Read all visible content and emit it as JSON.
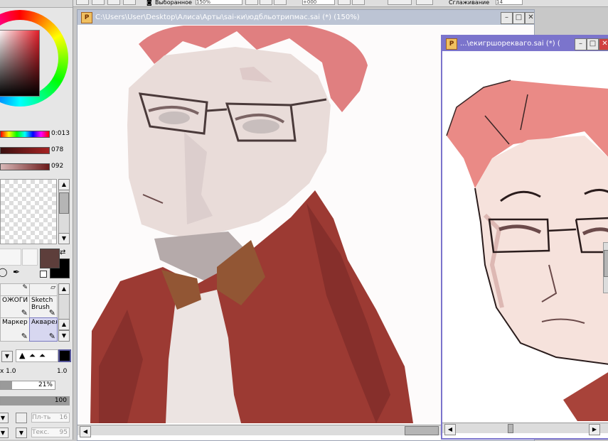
{
  "toolbar": {
    "stabilizer_label": "Выборанное",
    "zoom_value": "150%",
    "angle_value": "+000",
    "smoothing_label": "Сглаживание",
    "smoothing_value": "14"
  },
  "color_panel": {
    "hue_value": "0:013",
    "saturation_value": "078",
    "value_value": "092"
  },
  "colors": {
    "foreground": "#5d3e3b",
    "background": "#000000",
    "doc1_titlebar": "#bcc4d4",
    "doc2_titlebar": "#7b74cc"
  },
  "tools": {
    "contour_label": "ОЖОГИ",
    "sketch_brush_label": "Sketch Brush",
    "marker_label": "Маркер",
    "watercolor_label": "Акварел"
  },
  "brush": {
    "size_multiplier": "x 1.0",
    "size_value": "1.0",
    "min_size": "21%",
    "density": "100",
    "pl_label": "Пл-ть",
    "pl_value": "16",
    "tex_label": "Текс.",
    "tex_value": "95"
  },
  "documents": [
    {
      "title": "C:\\Users\\User\\Desktop\\Алиса\\Арты\\sai-ки\\юдбльотрипмас.sai (*) (150%)"
    },
    {
      "title": "...\\екигршорекваго.sai (*) ("
    }
  ],
  "icons": {
    "app": "sai-app-icon",
    "minimize": "minimize-icon",
    "maximize": "maximize-icon",
    "close": "close-icon"
  }
}
